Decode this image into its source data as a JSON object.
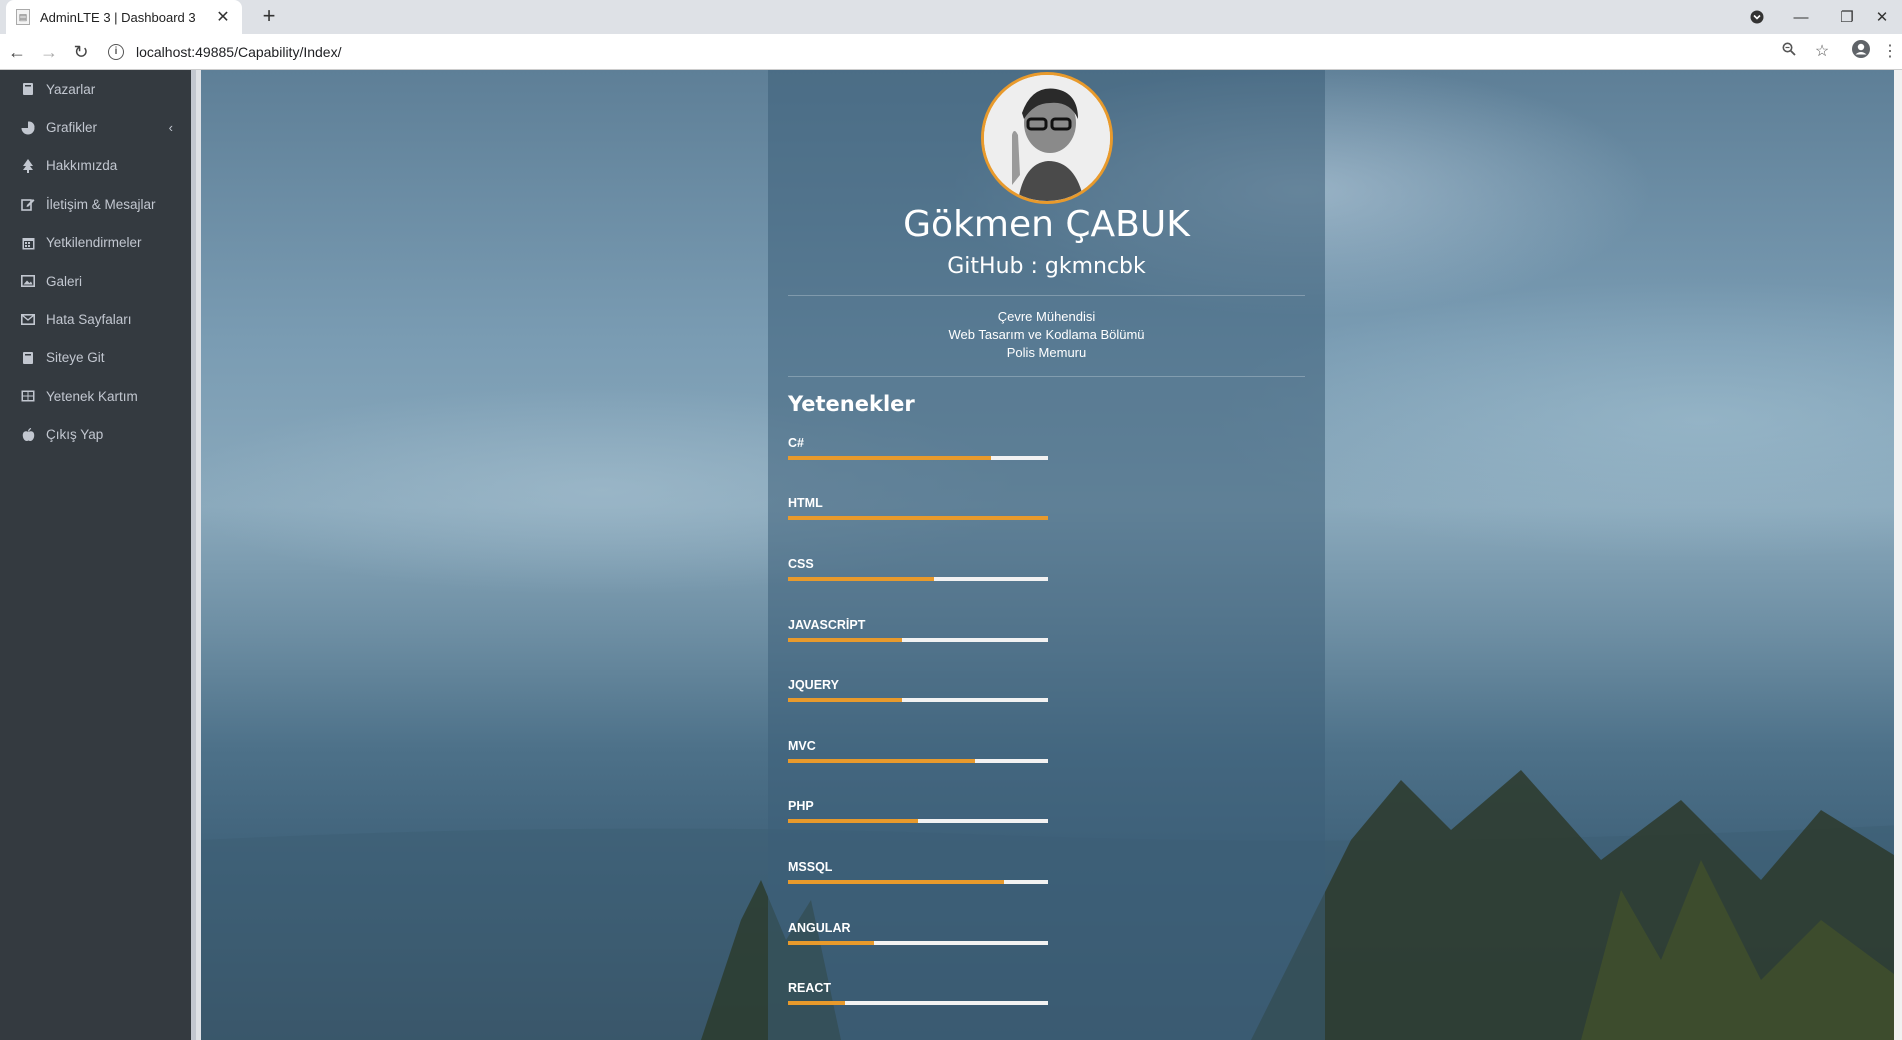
{
  "browser": {
    "tab_title": "AdminLTE 3 | Dashboard 3",
    "url": "localhost:49885/Capability/Index/"
  },
  "sidebar": {
    "items": [
      {
        "label": "Yazarlar",
        "icon": "book-icon"
      },
      {
        "label": "Grafikler",
        "icon": "pie-chart-icon"
      },
      {
        "label": "Hakkımızda",
        "icon": "tree-icon"
      },
      {
        "label": "İletişim & Mesajlar",
        "icon": "edit-icon"
      },
      {
        "label": "Yetkilendirmeler",
        "icon": "calendar-icon"
      },
      {
        "label": "Galeri",
        "icon": "image-icon"
      },
      {
        "label": "Hata Sayfaları",
        "icon": "envelope-icon"
      },
      {
        "label": "Siteye Git",
        "icon": "book-icon"
      },
      {
        "label": "Yetenek Kartım",
        "icon": "table-icon"
      },
      {
        "label": "Çıkış Yap",
        "icon": "apple-icon"
      }
    ]
  },
  "profile": {
    "name": "Gökmen ÇABUK",
    "github": "GitHub : gkmncbk",
    "jobs": [
      "Çevre Mühendisi",
      "Web Tasarım ve Kodlama Bölümü",
      "Polis Memuru"
    ],
    "skills_title": "Yetenekler",
    "skills": [
      {
        "name": "C#",
        "level": 78
      },
      {
        "name": "HTML",
        "level": 100
      },
      {
        "name": "CSS",
        "level": 56
      },
      {
        "name": "JAVASCRİPT",
        "level": 44
      },
      {
        "name": "JQUERY",
        "level": 44
      },
      {
        "name": "MVC",
        "level": 72
      },
      {
        "name": "PHP",
        "level": 50
      },
      {
        "name": "MSSQL",
        "level": 83
      },
      {
        "name": "ANGULAR",
        "level": 33
      },
      {
        "name": "REACT",
        "level": 22
      }
    ]
  },
  "colors": {
    "accent": "#e89a2c",
    "sidebar_bg": "#343a40",
    "sidebar_text": "#c2c7d0"
  }
}
